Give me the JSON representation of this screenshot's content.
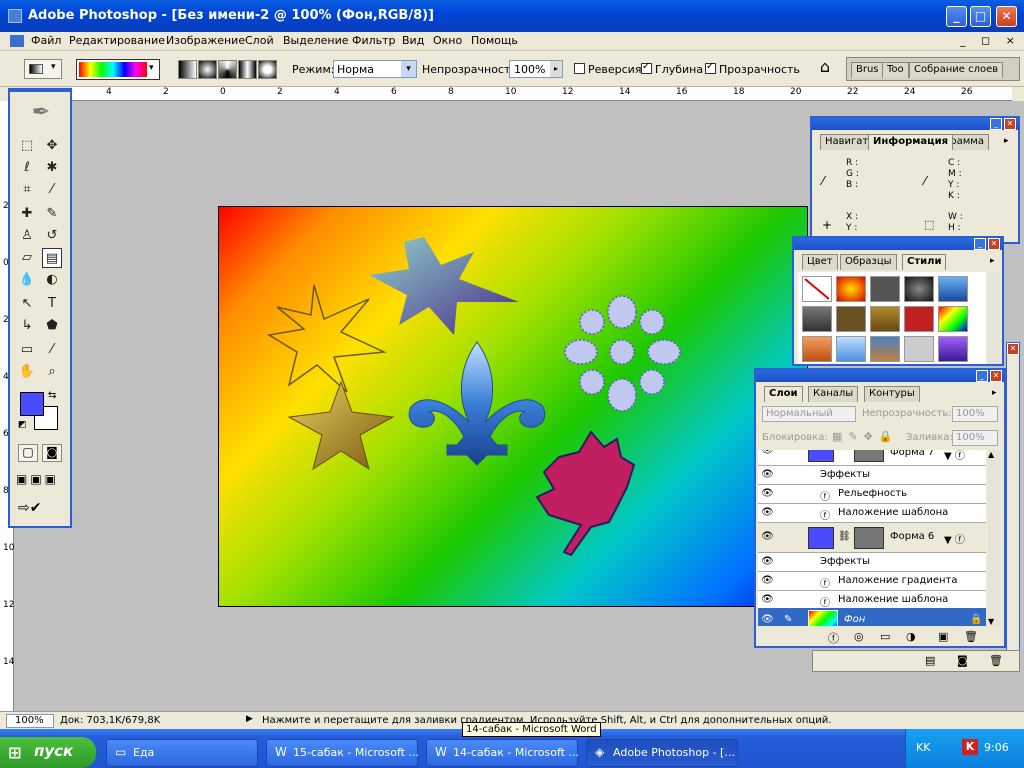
{
  "window": {
    "title": "Adobe Photoshop - [Без имени-2 @ 100% (Фон,RGB/8)]",
    "min": "_",
    "max": "□",
    "close": "✕"
  },
  "menu": {
    "items": [
      "Файл",
      "Редактирование",
      "Изображение",
      "Слой",
      "Выделение",
      "Фильтр",
      "Вид",
      "Окно",
      "Помощь"
    ],
    "mdi": "_ ◻ ×"
  },
  "options": {
    "mode_label": "Режим:",
    "mode_value": "Норма",
    "opacity_label": "Непрозрачность:",
    "opacity_value": "100%",
    "reverse": "Реверсия",
    "dither": "Глубина",
    "transparency": "Прозрачность",
    "well_tabs": [
      "Brus",
      "Too",
      "Собрание слоев"
    ]
  },
  "ruler": {
    "top": [
      "4",
      "2",
      "0",
      "2",
      "4",
      "6",
      "8",
      "10",
      "12",
      "14",
      "16",
      "18",
      "20",
      "22",
      "24",
      "26"
    ],
    "left": [
      "2",
      "0",
      "2",
      "4",
      "6",
      "8",
      "10",
      "12",
      "14",
      "1"
    ]
  },
  "info_panel": {
    "tabs": [
      "Навигат",
      "Информация",
      "грамма"
    ],
    "rgb": [
      "R :",
      "G :",
      "B :"
    ],
    "cmyk": [
      "C :",
      "M :",
      "Y :",
      "K :"
    ],
    "xy": [
      "X :",
      "Y :"
    ],
    "wh": [
      "W :",
      "H :"
    ]
  },
  "styles_panel": {
    "tabs": [
      "Цвет",
      "Образцы",
      "Стили"
    ]
  },
  "layers_panel": {
    "tabs": [
      "Слои",
      "Каналы",
      "Контуры"
    ],
    "blend": "Нормальный",
    "opacity_label": "Непрозрачность:",
    "opacity_value": "100%",
    "lock_label": "Блокировка:",
    "fill_label": "Заливка:",
    "fill_value": "100%",
    "rows": [
      {
        "text": "Форма 7",
        "type": "shape"
      },
      {
        "text": "Эффекты",
        "type": "fx-head"
      },
      {
        "text": "Рельефность",
        "type": "fx"
      },
      {
        "text": "Наложение шаблона",
        "type": "fx"
      },
      {
        "text": "Форма 6",
        "type": "shape"
      },
      {
        "text": "Эффекты",
        "type": "fx-head"
      },
      {
        "text": "Наложение градиента",
        "type": "fx"
      },
      {
        "text": "Наложение шаблона",
        "type": "fx"
      },
      {
        "text": "Фон",
        "type": "background"
      }
    ]
  },
  "status": {
    "zoom": "100%",
    "doc": "Док: 703,1K/679,8K",
    "hint": "Нажмите и перетащите для заливки градиентом. Используйте Shift, Alt, и Ctrl для дополнительных опций."
  },
  "taskbar": {
    "start": "пуск",
    "tasks": [
      "Еда",
      "15-сабак - Microsoft ...",
      "14-сабак - Microsoft ...",
      "Adobe Photoshop - [..."
    ],
    "tooltip": "14-сабак - Microsoft Word",
    "lang": "KK",
    "time": "9:06"
  },
  "colors": {
    "foreground": "#4a4aff",
    "background": "#ffffff",
    "accent": "#2b5fd8"
  }
}
